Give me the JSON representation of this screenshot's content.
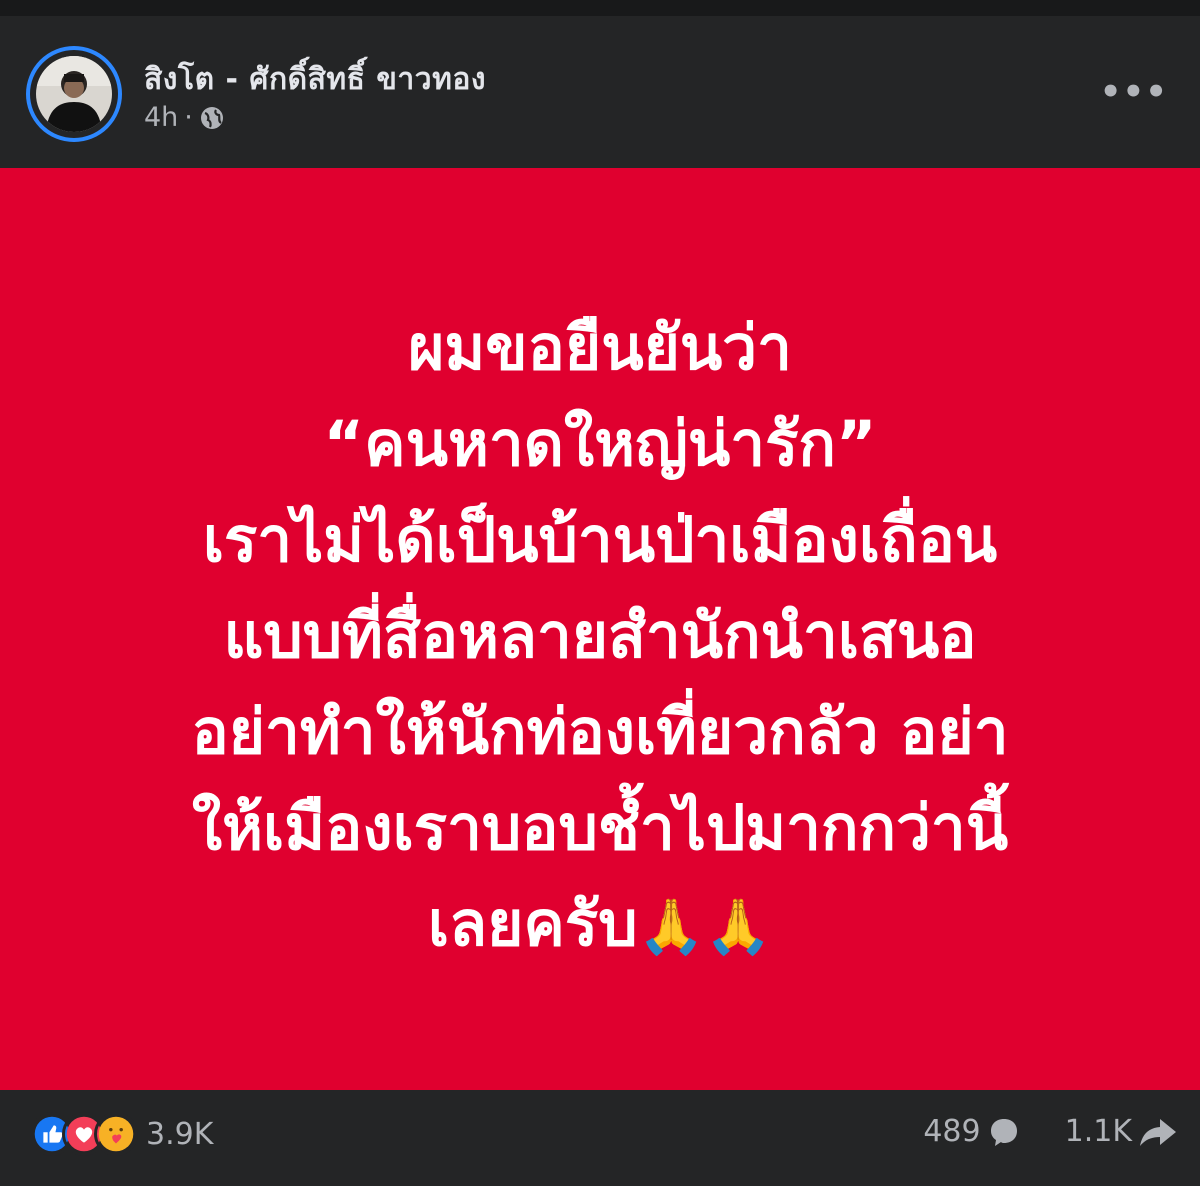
{
  "post": {
    "author": "สิงโต - ศักดิ์สิทธิ์ ขาวทอง",
    "time": "4h",
    "separator": "·",
    "more": "•••",
    "lines": [
      "ผมขอยืนยันว่า",
      "“คนหาดใหญ่น่ารัก”",
      "เราไม่ได้เป็นบ้านป่าเมืองเถื่อน",
      "แบบที่สื่อหลายสำนักนำเสนอ",
      "อย่าทำให้นักท่องเที่ยวกลัว อย่า",
      "ให้เมืองเราบอบช้ำไปมากกว่านี้",
      "เลยครับ"
    ],
    "emoji": "🙏🙏"
  },
  "footer": {
    "reaction_count": "3.9K",
    "comments": "489",
    "shares": "1.1K"
  },
  "colors": {
    "banner": "#e0002f",
    "card": "#242526",
    "accent": "#2d88ff"
  },
  "icons": [
    "globe-icon",
    "like-icon",
    "love-icon",
    "care-icon",
    "comment-icon",
    "share-icon",
    "more-icon"
  ]
}
